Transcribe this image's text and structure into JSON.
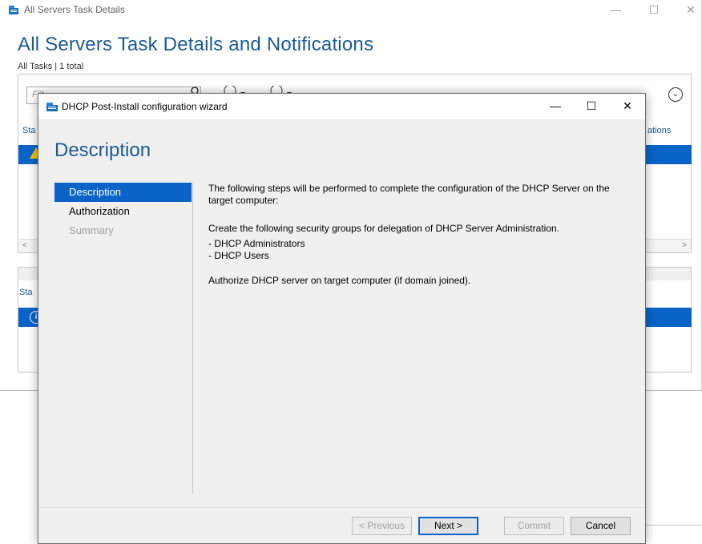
{
  "background_window": {
    "title": "All Servers Task Details",
    "heading": "All Servers Task Details and Notifications",
    "subheading": "All Tasks | 1 total",
    "filter_placeholder": "Filt",
    "col_status": "Sta",
    "col_notifications": "ations",
    "col_status2": "Sta",
    "info_glyph": "i",
    "scroll_left": "<",
    "scroll_right": ">",
    "expand_glyph": "⌄",
    "min_glyph": "—",
    "max_glyph": "☐",
    "close_glyph": "✕",
    "accent_color": "#1b5a96",
    "selection_color": "#0a64c8"
  },
  "dialog": {
    "title": "DHCP Post-Install configuration wizard",
    "min_glyph": "—",
    "max_glyph": "☐",
    "close_glyph": "✕",
    "heading": "Description",
    "nav": [
      {
        "label": "Description",
        "state": "active"
      },
      {
        "label": "Authorization",
        "state": "normal"
      },
      {
        "label": "Summary",
        "state": "disabled"
      }
    ],
    "content": {
      "intro_line1": "The following steps will be performed to complete the configuration of the DHCP Server on the",
      "intro_line2": "target computer:",
      "groups_intro": "Create the following security groups for delegation of DHCP Server Administration.",
      "group1": "- DHCP Administrators",
      "group2": "- DHCP Users",
      "authorize": "Authorize DHCP server on target computer (if domain joined)."
    },
    "buttons": {
      "previous": "< Previous",
      "next": "Next >",
      "commit": "Commit",
      "cancel": "Cancel"
    }
  }
}
